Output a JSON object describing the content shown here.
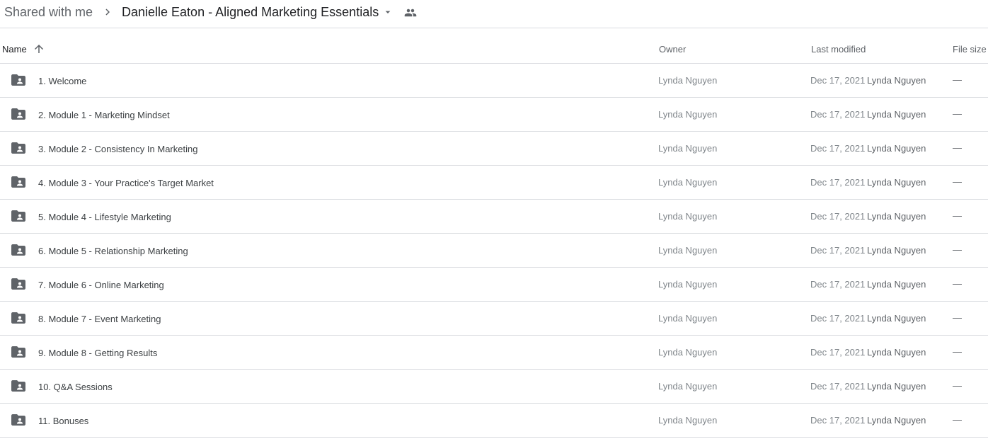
{
  "breadcrumb": {
    "root": "Shared with me",
    "current": "Danielle Eaton - Aligned Marketing Essentials"
  },
  "columns": {
    "name": "Name",
    "owner": "Owner",
    "last_modified": "Last modified",
    "file_size": "File size"
  },
  "sort": {
    "column": "Name",
    "direction": "ascending"
  },
  "colors": {
    "folder_icon": "#5f6368",
    "divider": "#dadce0"
  },
  "rows": [
    {
      "name": "1. Welcome",
      "owner": "Lynda Nguyen",
      "modified_date": "Dec 17, 2021",
      "modified_by": "Lynda Nguyen",
      "size": "—"
    },
    {
      "name": "2. Module 1 - Marketing Mindset",
      "owner": "Lynda Nguyen",
      "modified_date": "Dec 17, 2021",
      "modified_by": "Lynda Nguyen",
      "size": "—"
    },
    {
      "name": "3. Module 2 - Consistency In Marketing",
      "owner": "Lynda Nguyen",
      "modified_date": "Dec 17, 2021",
      "modified_by": "Lynda Nguyen",
      "size": "—"
    },
    {
      "name": "4. Module 3 - Your Practice's Target Market",
      "owner": "Lynda Nguyen",
      "modified_date": "Dec 17, 2021",
      "modified_by": "Lynda Nguyen",
      "size": "—"
    },
    {
      "name": "5. Module 4 - Lifestyle Marketing",
      "owner": "Lynda Nguyen",
      "modified_date": "Dec 17, 2021",
      "modified_by": "Lynda Nguyen",
      "size": "—"
    },
    {
      "name": "6. Module 5 - Relationship Marketing",
      "owner": "Lynda Nguyen",
      "modified_date": "Dec 17, 2021",
      "modified_by": "Lynda Nguyen",
      "size": "—"
    },
    {
      "name": "7. Module 6 - Online Marketing",
      "owner": "Lynda Nguyen",
      "modified_date": "Dec 17, 2021",
      "modified_by": "Lynda Nguyen",
      "size": "—"
    },
    {
      "name": "8. Module 7 - Event Marketing",
      "owner": "Lynda Nguyen",
      "modified_date": "Dec 17, 2021",
      "modified_by": "Lynda Nguyen",
      "size": "—"
    },
    {
      "name": "9. Module 8 - Getting Results",
      "owner": "Lynda Nguyen",
      "modified_date": "Dec 17, 2021",
      "modified_by": "Lynda Nguyen",
      "size": "—"
    },
    {
      "name": "10. Q&A Sessions",
      "owner": "Lynda Nguyen",
      "modified_date": "Dec 17, 2021",
      "modified_by": "Lynda Nguyen",
      "size": "—"
    },
    {
      "name": "11. Bonuses",
      "owner": "Lynda Nguyen",
      "modified_date": "Dec 17, 2021",
      "modified_by": "Lynda Nguyen",
      "size": "—"
    }
  ]
}
